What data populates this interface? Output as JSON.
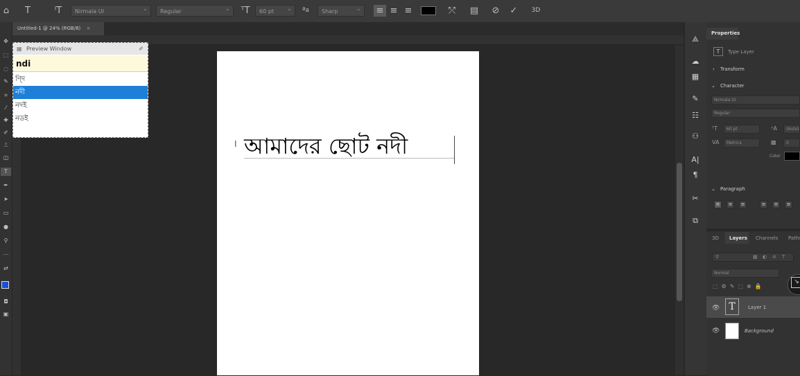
{
  "options_bar": {
    "home_icon": "home-icon",
    "type_tool_icon": "T",
    "orientation_icon": "ᴵT",
    "font_family": "Nirmala UI",
    "font_style": "Regular",
    "font_size_icon": "ᵀT",
    "font_size": "60 pt",
    "aa_icon": "ªa",
    "anti_alias": "Sharp",
    "align_left": "≡",
    "align_center": "≡",
    "align_right": "≡",
    "color": "#000000",
    "warp_icon": "⤲",
    "panels_icon": "▤",
    "cancel_icon": "⊘",
    "commit_icon": "✓",
    "threed_icon": "3D"
  },
  "document_tab": {
    "label": "Untitled-1 @ 24% (RGB/8)",
    "close": "×"
  },
  "preview_window": {
    "title": "Preview Window",
    "pin": "✐",
    "input": "ndi",
    "suggestions": [
      "ণ্দি",
      "নদী",
      "নদই",
      "নডই"
    ],
    "selected_index": 1
  },
  "canvas": {
    "text": "আমাদের ছোট নদী",
    "cursor": "I"
  },
  "properties": {
    "tab": "Properties",
    "layer_kind": "Type Layer",
    "transform_header": "Transform",
    "character_header": "Character",
    "font_family": "Nirmala UI",
    "font_style": "Regular",
    "font_size": "60 pt",
    "leading": "(Auto)",
    "kerning": "Metrics",
    "tracking": "0",
    "color_label": "Color",
    "paragraph_header": "Paragraph"
  },
  "layers_panel": {
    "tabs": [
      "3D",
      "Layers",
      "Channels",
      "Paths"
    ],
    "active_tab": "Layers",
    "blend_mode": "Normal",
    "layers": [
      {
        "name": "Layer 1",
        "type": "text",
        "thumb": "T"
      },
      {
        "name": "Background",
        "type": "fill",
        "thumb": ""
      }
    ]
  },
  "colors": {
    "selection_blue": "#1e7fd8",
    "panel_bg": "#323232",
    "canvas_bg": "#282828"
  }
}
